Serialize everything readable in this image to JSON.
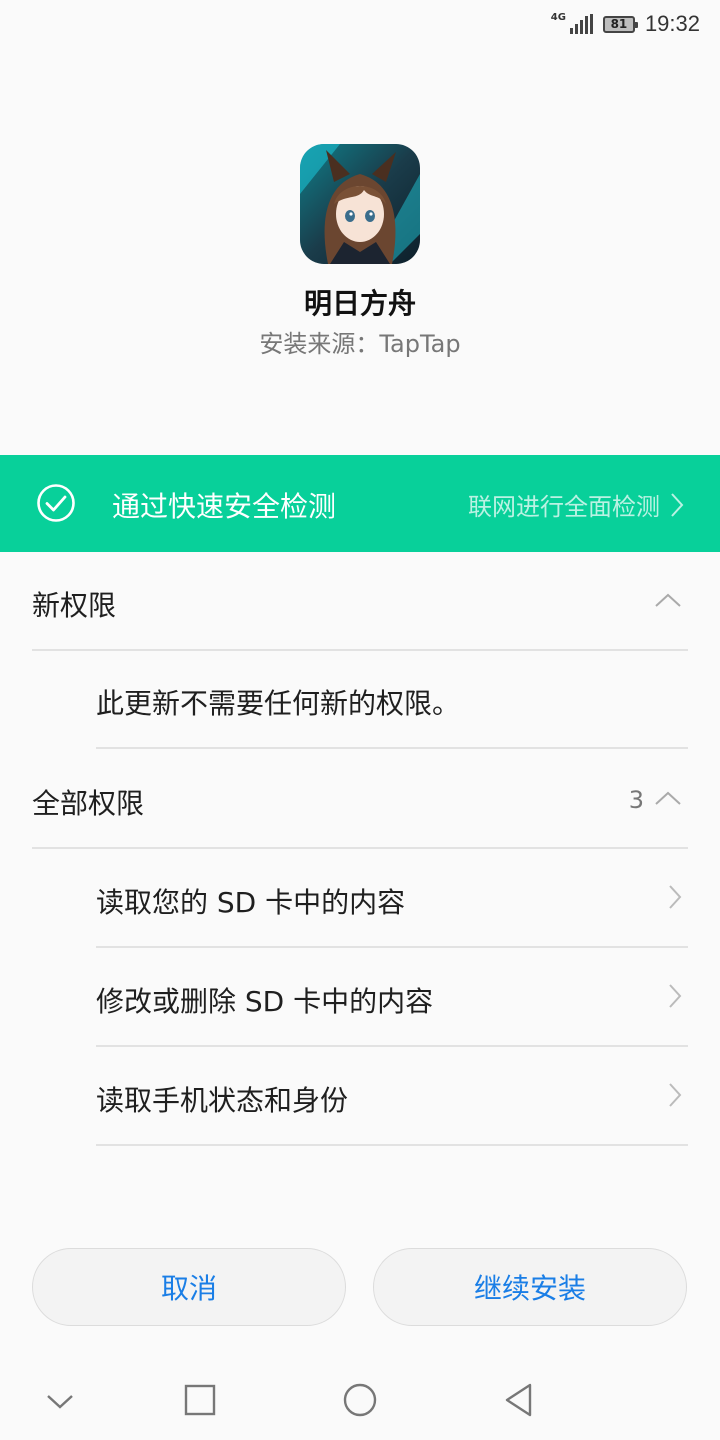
{
  "status_bar": {
    "network": "4G",
    "battery": "81",
    "time": "19:32"
  },
  "app": {
    "name": "明日方舟",
    "source": "安装来源：TapTap",
    "icon_name": "app-icon"
  },
  "security": {
    "status": "通过快速安全检测",
    "link": "联网进行全面检测"
  },
  "new_permissions": {
    "title": "新权限",
    "message": "此更新不需要任何新的权限。"
  },
  "all_permissions": {
    "title": "全部权限",
    "count": "3",
    "items": [
      {
        "label": "读取您的 SD 卡中的内容"
      },
      {
        "label": "修改或删除 SD 卡中的内容"
      },
      {
        "label": "读取手机状态和身份"
      }
    ]
  },
  "buttons": {
    "cancel": "取消",
    "continue": "继续安装"
  },
  "colors": {
    "banner": "#08d09a",
    "button_text": "#1a7ee6"
  }
}
